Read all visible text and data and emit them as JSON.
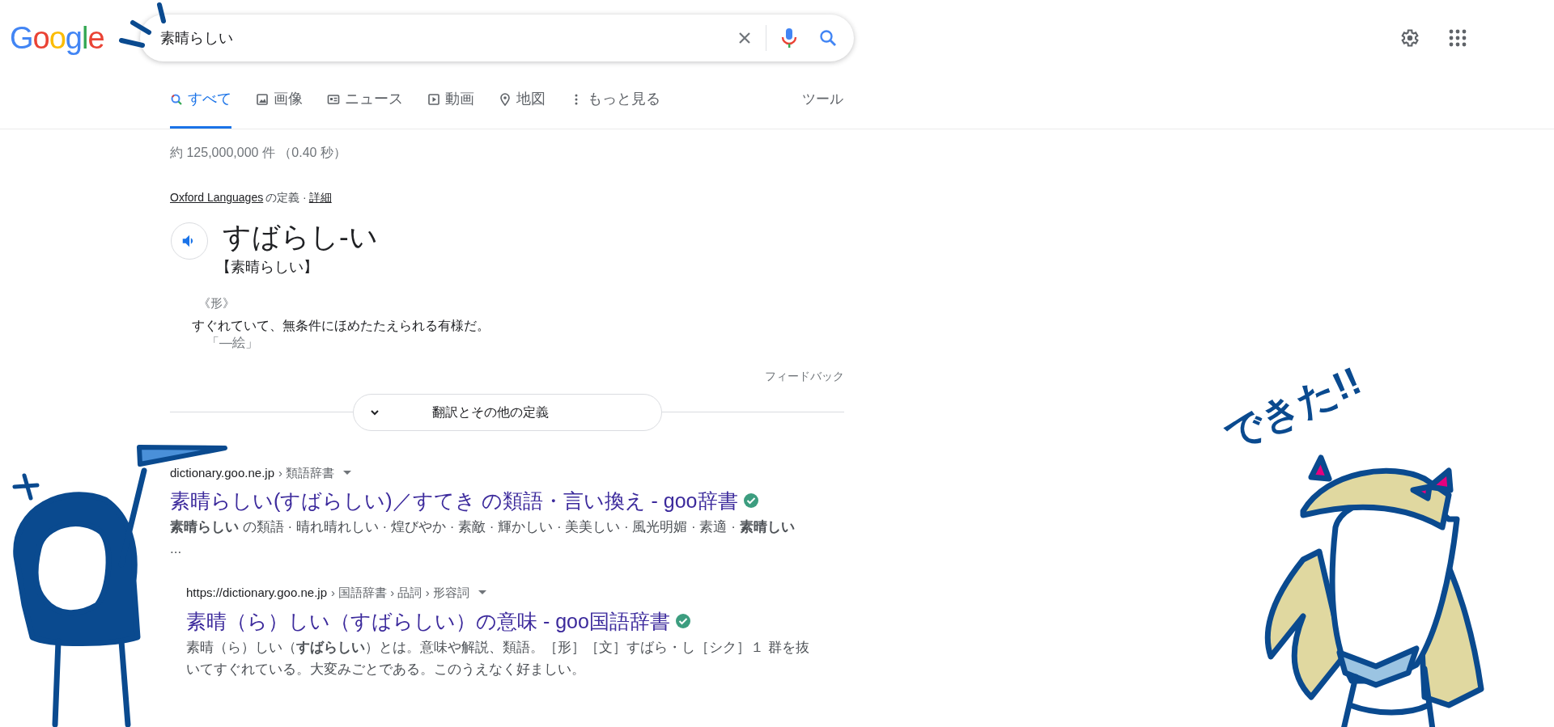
{
  "logo": "Google",
  "search": {
    "value": "素晴らしい"
  },
  "tabs": [
    {
      "label": "すべて",
      "selected": true
    },
    {
      "label": "画像",
      "selected": false
    },
    {
      "label": "ニュース",
      "selected": false
    },
    {
      "label": "動画",
      "selected": false
    },
    {
      "label": "地図",
      "selected": false
    },
    {
      "label": "もっと見る",
      "selected": false
    }
  ],
  "tools": "ツール",
  "result_stats": "約 125,000,000 件 （0.40 秒）",
  "dictionary": {
    "source_link": "Oxford Languages",
    "source_text": "の定義 ·",
    "details_link": "詳細",
    "headword": "すばらし-い",
    "kanji": "【素晴らしい】",
    "part_of_speech": "《形》",
    "definition": "すぐれていて、無条件にほめたたえられる有様だ。",
    "example": "「—絵」",
    "feedback": "フィードバック",
    "more_button": "翻訳とその他の定義"
  },
  "results": [
    {
      "url": "dictionary.goo.ne.jp",
      "breadcrumb": "› 類語辞書",
      "title": "素晴らしい(すばらしい)／すてき の類語・言い換え - goo辞書",
      "verified": true,
      "snippet": "**素晴らしい** の類語 · 晴れ晴れしい · 煌びやか · 素敵 · 輝かしい · 美美しい · 風光明媚 · 素適 · **素晴しい** ...",
      "children": [
        {
          "url": "https://dictionary.goo.ne.jp",
          "breadcrumb": "› 国語辞書 › 品詞 › 形容詞",
          "title": "素晴（ら）しい（すばらしい）の意味 - goo国語辞書",
          "verified": true,
          "snippet": "素晴（ら）しい（**すばらしい**）とは。意味や解説、類語。［形］［文］すばら・し［シク］１ 群を抜いてすぐれている。大変みごとである。このうえなく好ましい。"
        }
      ]
    }
  ],
  "illustration": {
    "caption": "できた!!"
  }
}
